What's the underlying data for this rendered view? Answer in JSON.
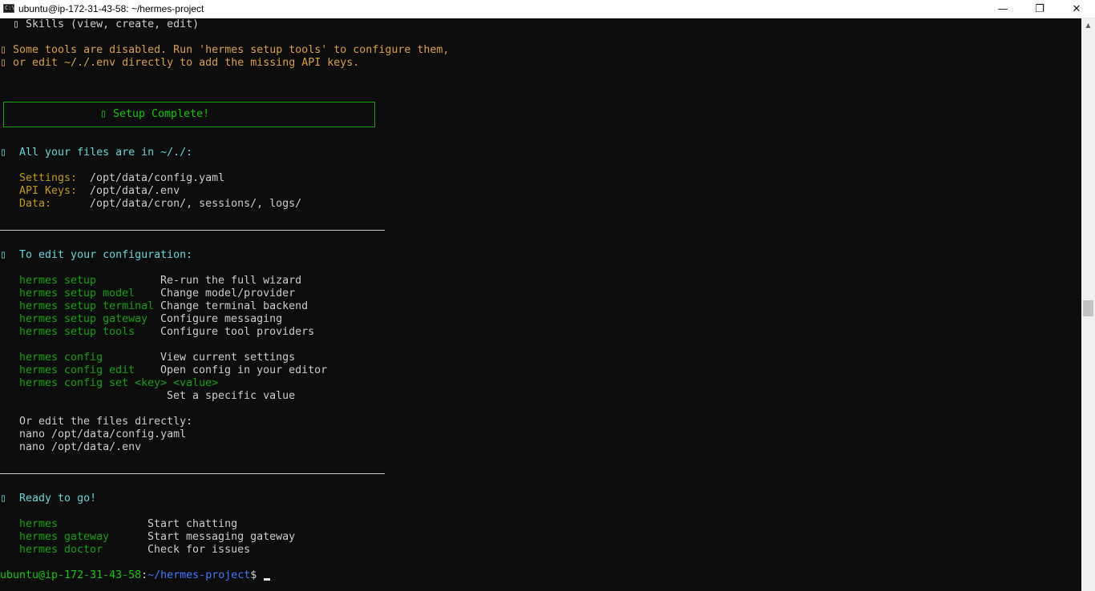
{
  "window": {
    "title": "ubuntu@ip-172-31-43-58: ~/hermes-project",
    "icon": "console-icon",
    "icon_glyph": "C:\\",
    "controls": {
      "minimize": "—",
      "maximize": "❐",
      "close": "✕"
    }
  },
  "terminal": {
    "skills_line": "  ▯ Skills (view, create, edit)",
    "warning": [
      "▯ Some tools are disabled. Run 'hermes setup tools' to configure them,",
      "▯ or edit ~/./.env directly to add the missing API keys."
    ],
    "setup_complete": "▯ Setup Complete!",
    "files_heading": "▯  All your files are in ~/./:",
    "files": [
      {
        "label": "Settings:",
        "value": "/opt/data/config.yaml"
      },
      {
        "label": "API Keys:",
        "value": "/opt/data/.env"
      },
      {
        "label": "Data:",
        "value": "/opt/data/cron/, sessions/, logs/"
      }
    ],
    "edit_heading": "▯  To edit your configuration:",
    "setup_commands": [
      {
        "cmd": "hermes setup",
        "desc": "Re-run the full wizard"
      },
      {
        "cmd": "hermes setup model",
        "desc": "Change model/provider"
      },
      {
        "cmd": "hermes setup terminal",
        "desc": "Change terminal backend"
      },
      {
        "cmd": "hermes setup gateway",
        "desc": "Configure messaging"
      },
      {
        "cmd": "hermes setup tools",
        "desc": "Configure tool providers"
      }
    ],
    "config_commands": [
      {
        "cmd": "hermes config",
        "desc": "View current settings"
      },
      {
        "cmd": "hermes config edit",
        "desc": "Open config in your editor"
      }
    ],
    "config_set": {
      "cmd": "hermes config set <key> <value>",
      "desc": "Set a specific value"
    },
    "edit_directly_heading": "Or edit the files directly:",
    "edit_directly": [
      "nano /opt/data/config.yaml",
      "nano /opt/data/.env"
    ],
    "ready_heading": "▯  Ready to go!",
    "ready_commands": [
      {
        "cmd": "hermes",
        "desc": "Start chatting"
      },
      {
        "cmd": "hermes gateway",
        "desc": "Start messaging gateway"
      },
      {
        "cmd": "hermes doctor",
        "desc": "Check for issues"
      }
    ],
    "prompt": {
      "user_host": "ubuntu@ip-172-31-43-58",
      "separator": ":",
      "path": "~/hermes-project",
      "symbol": "$"
    }
  },
  "colors": {
    "background": "#0c0c0c",
    "warning": "#c19c00",
    "heading": "#61d6d6",
    "label": "#c19c00",
    "command": "#13a10e",
    "success": "#16c60c",
    "path": "#3b78ff"
  },
  "scrollbar": {
    "up_arrow": "▲"
  }
}
